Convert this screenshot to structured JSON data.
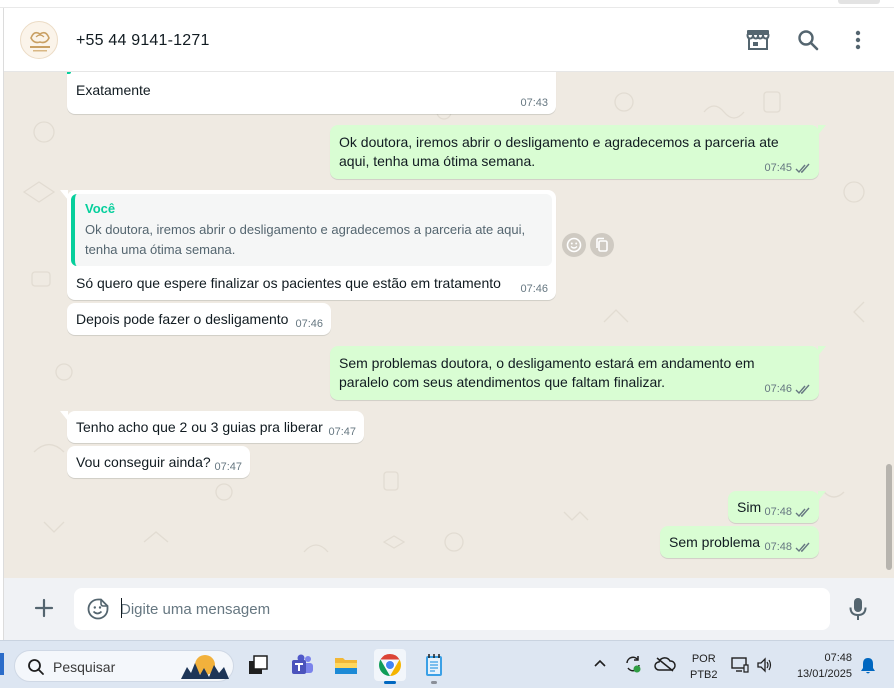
{
  "header": {
    "contact_name": "+55 44 9141-1271"
  },
  "messages": [
    {
      "direction": "in",
      "text": "Exatamente",
      "time": "07:43"
    },
    {
      "direction": "out",
      "lines": [
        "Ok doutora, iremos abrir o desligamento e agradecemos a parceria ate",
        "aqui, tenha uma ótima semana."
      ],
      "time": "07:45"
    },
    {
      "direction": "in",
      "quote_author": "Você",
      "quote_lines": [
        "Ok doutora, iremos abrir o desligamento e agradecemos a parceria ate aqui,",
        "tenha uma ótima semana."
      ],
      "text": "Só quero que espere finalizar os pacientes que estão em tratamento",
      "time": "07:46"
    },
    {
      "direction": "in",
      "text": "Depois pode fazer o desligamento",
      "time": "07:46"
    },
    {
      "direction": "out",
      "lines": [
        "Sem problemas doutora, o desligamento estará em andamento em",
        "paralelo com seus atendimentos que faltam finalizar."
      ],
      "time": "07:46"
    },
    {
      "direction": "in",
      "text": "Tenho acho que 2 ou 3 guias pra liberar",
      "time": "07:47"
    },
    {
      "direction": "in",
      "text": "Vou conseguir ainda?",
      "time": "07:47"
    },
    {
      "direction": "out",
      "text": "Sim",
      "time": "07:48"
    },
    {
      "direction": "out",
      "text": "Sem problema",
      "time": "07:48"
    }
  ],
  "composer": {
    "placeholder": "Digite uma mensagem"
  },
  "taskbar": {
    "search_label": "Pesquisar",
    "language": "POR",
    "layout": "PTB2",
    "time": "07:48",
    "date": "13/01/2025"
  },
  "colors": {
    "outgoing_bubble": "#d9fdd3",
    "incoming_bubble": "#ffffff",
    "chat_background": "#efeae2",
    "accent": "#06cf9c",
    "read_ticks": "#667781"
  }
}
